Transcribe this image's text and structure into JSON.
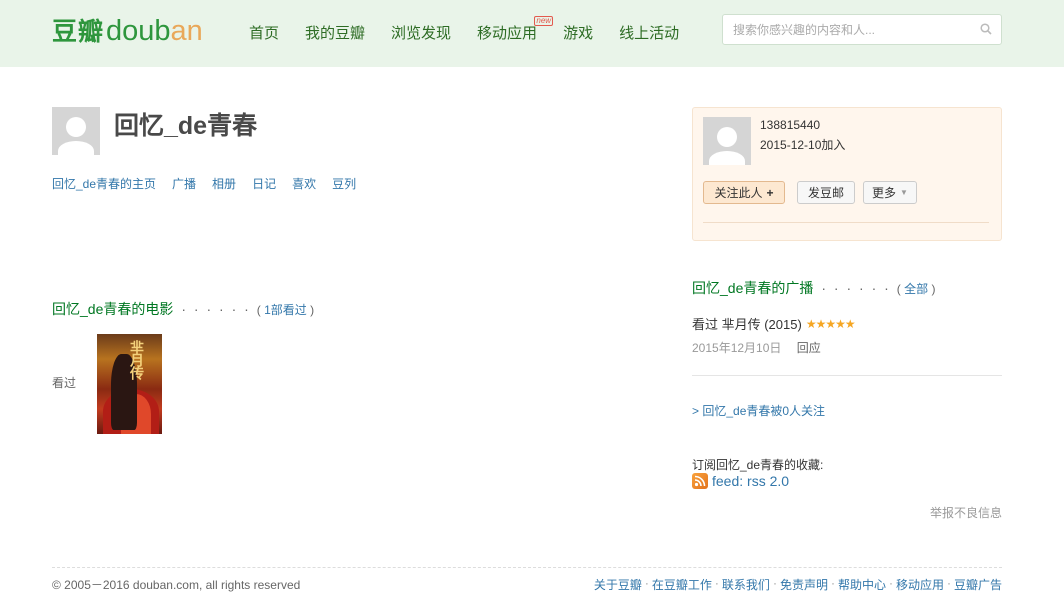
{
  "header": {
    "logo_cn": "豆瓣",
    "logo_en": "douban",
    "nav": [
      {
        "label": "首页"
      },
      {
        "label": "我的豆瓣"
      },
      {
        "label": "浏览发现"
      },
      {
        "label": "移动应用",
        "badge": "new"
      },
      {
        "label": "游戏"
      },
      {
        "label": "线上活动"
      }
    ],
    "search": {
      "placeholder": "搜索你感兴趣的内容和人..."
    }
  },
  "profile": {
    "name": "回忆_de青春",
    "subnav": [
      "回忆_de青春的主页",
      "广播",
      "相册",
      "日记",
      "喜欢",
      "豆列"
    ]
  },
  "movies": {
    "title": "回忆_de青春的电影",
    "dots": "· · · · · ·",
    "count_open": "( ",
    "count_link": "1部看过",
    "count_close": " )",
    "label": "看过",
    "poster_title": "芈月传"
  },
  "card": {
    "uid": "138815440",
    "joined": "2015-12-10加入",
    "follow_label": "关注此人",
    "mail_label": "发豆邮",
    "more_label": "更多"
  },
  "broadcast": {
    "title": "回忆_de青春的广播",
    "dots": "· · · · · ·",
    "all_open": "( ",
    "all_link": "全部",
    "all_close": " )",
    "status_text": "看过 芈月传 (2015)",
    "rating": 5,
    "date": "2015年12月10日",
    "reply": "回应"
  },
  "followers_text": "> 回忆_de青春被0人关注",
  "subscribe_label": "订阅回忆_de青春的收藏:",
  "rss_label": "feed: rss 2.0",
  "report_label": "举报不良信息",
  "footer": {
    "copyright": "© 2005－2016 douban.com, all rights reserved",
    "links": [
      "关于豆瓣",
      "在豆瓣工作",
      "联系我们",
      "免责声明",
      "帮助中心",
      "移动应用",
      "豆瓣广告"
    ]
  },
  "colors": {
    "brand_green": "#2e963d",
    "nav_bg": "#e9f4e9",
    "link_blue": "#3377aa",
    "star": "#f5a623"
  }
}
